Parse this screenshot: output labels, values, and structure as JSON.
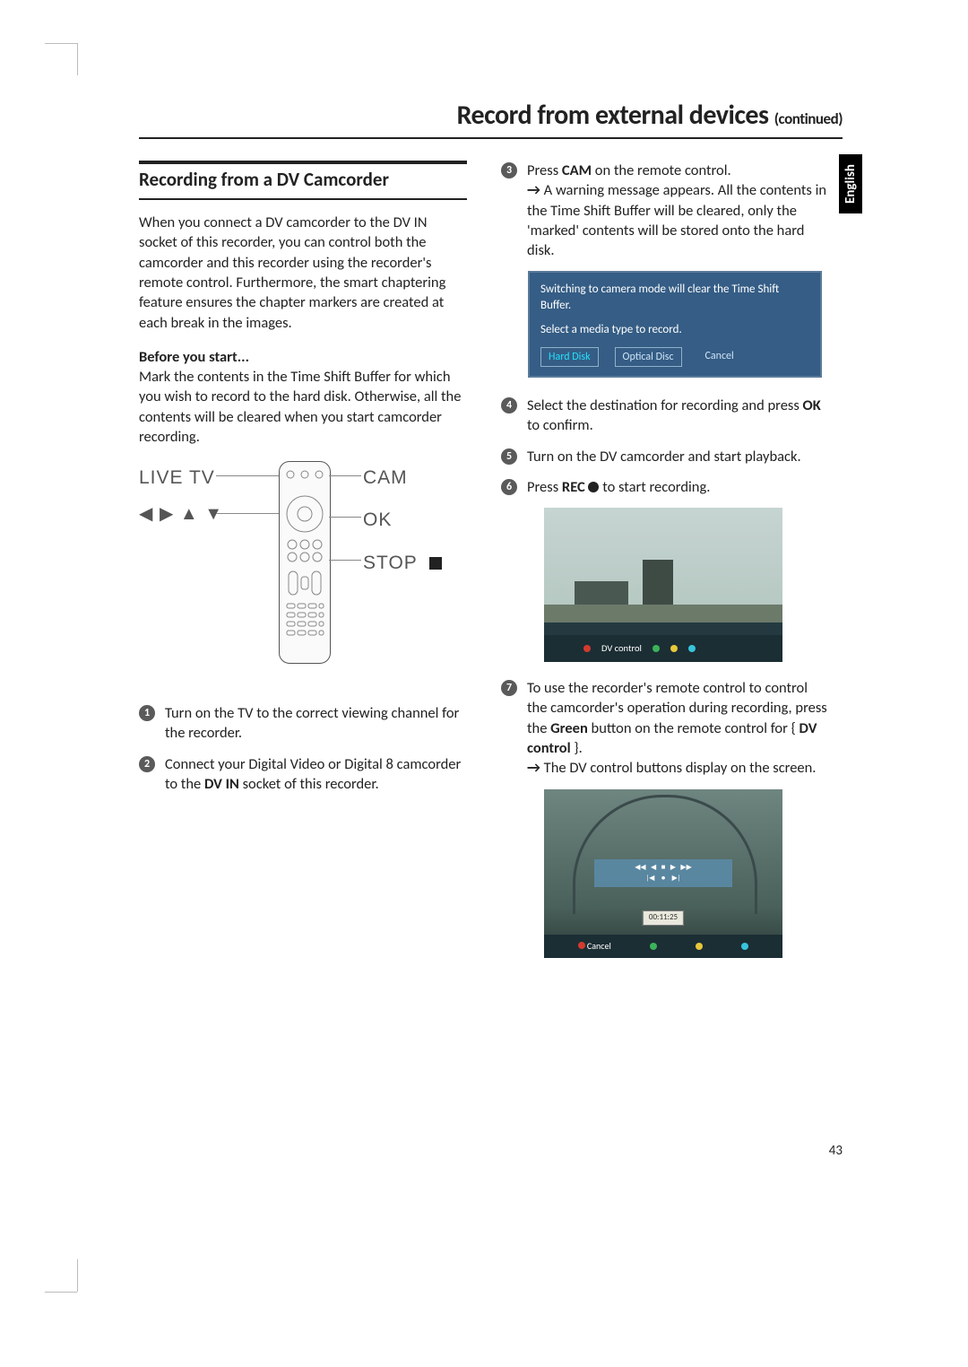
{
  "page_number": "43",
  "lang_tab": "English",
  "title_main": "Record from external devices",
  "title_cont": "(continued)",
  "left": {
    "heading": "Recording from a DV Camcorder",
    "intro": "When you connect a DV camcorder to the DV IN socket of this recorder, you can control both the camcorder and this recorder using the recorder's remote control. Furthermore, the smart chaptering feature ensures the chapter markers are created at each break in the images.",
    "before_label": "Before you start...",
    "before_body": "Mark the contents in the Time Shift Buffer for which you wish to record to the hard disk. Otherwise, all the contents will be cleared when you start camcorder recording.",
    "remote": {
      "live": "LIVE TV",
      "cam": "CAM",
      "ok": "OK",
      "stop": "STOP",
      "arrows": "◀ ▶ ▲ ▼"
    },
    "step1": "Turn on the TV to the correct viewing channel for the recorder.",
    "step2_a": "Connect your Digital Video or Digital 8 camcorder to the ",
    "step2_b": "DV IN",
    "step2_c": " socket of this recorder."
  },
  "right": {
    "step3_a": "Press ",
    "step3_b": "CAM",
    "step3_c": " on the remote control.",
    "step3_r1": "A warning message appears. All the contents in the Time Shift Buffer will be cleared, only the 'marked' contents will be stored onto the hard disk.",
    "dialog": {
      "line1": "Switching to camera mode will clear the Time Shift Buffer.",
      "line2": "Select a media type to record.",
      "btn1": "Hard Disk",
      "btn2": "Optical Disc",
      "btn3": "Cancel"
    },
    "step4_a": "Select the destination for recording and press ",
    "step4_b": "OK",
    "step4_c": " to confirm.",
    "step5": "Turn on the DV camcorder and start playback.",
    "step6_a": "Press ",
    "step6_b": "REC",
    "step6_c": " to start recording.",
    "shot1_label": "DV control",
    "step7_a": "To use the recorder's remote control to control the camcorder's operation during recording, press the ",
    "step7_b": "Green",
    "step7_c": " button on the remote control for { ",
    "step7_d": "DV control",
    "step7_e": " }.",
    "step7_r": "The DV control buttons display on the screen.",
    "shot2_time": "00:11:25",
    "shot2_cancel": "Cancel"
  }
}
